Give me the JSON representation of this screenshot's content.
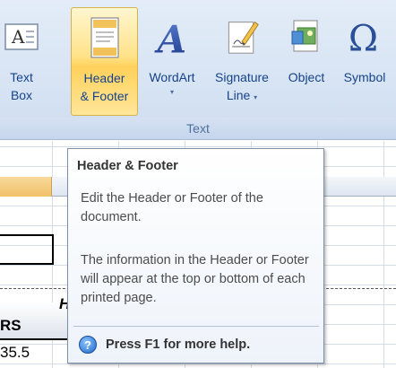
{
  "ribbon": {
    "buttons": [
      {
        "line1": "Text",
        "line2": "Box",
        "icon": "text-box-icon"
      },
      {
        "line1": "Header",
        "line2": "& Footer",
        "icon": "header-footer-icon"
      },
      {
        "line1": "WordArt",
        "line2": "",
        "icon": "wordart-icon",
        "has_dropdown": true
      },
      {
        "line1": "Signature",
        "line2": "Line",
        "icon": "signature-line-icon",
        "has_dropdown": true
      },
      {
        "line1": "Object",
        "line2": "",
        "icon": "object-icon"
      },
      {
        "line1": "Symbol",
        "line2": "",
        "icon": "symbol-icon"
      }
    ],
    "group_label": "Text",
    "dropdown_glyph": "▾"
  },
  "sheet": {
    "rs_text": "RS",
    "h_fragment": "H",
    "number": "35.5"
  },
  "tooltip": {
    "title": "Header & Footer",
    "description": "Edit the Header or Footer of the document.",
    "details": "The information in the Header or Footer will appear at the top or bottom of each printed page.",
    "help_text": "Press F1 for more help.",
    "help_icon": "help-icon"
  },
  "colors": {
    "ribbon_text": "#15428b",
    "active_button": "#ffd15b",
    "group_label": "#4f6f9c"
  }
}
